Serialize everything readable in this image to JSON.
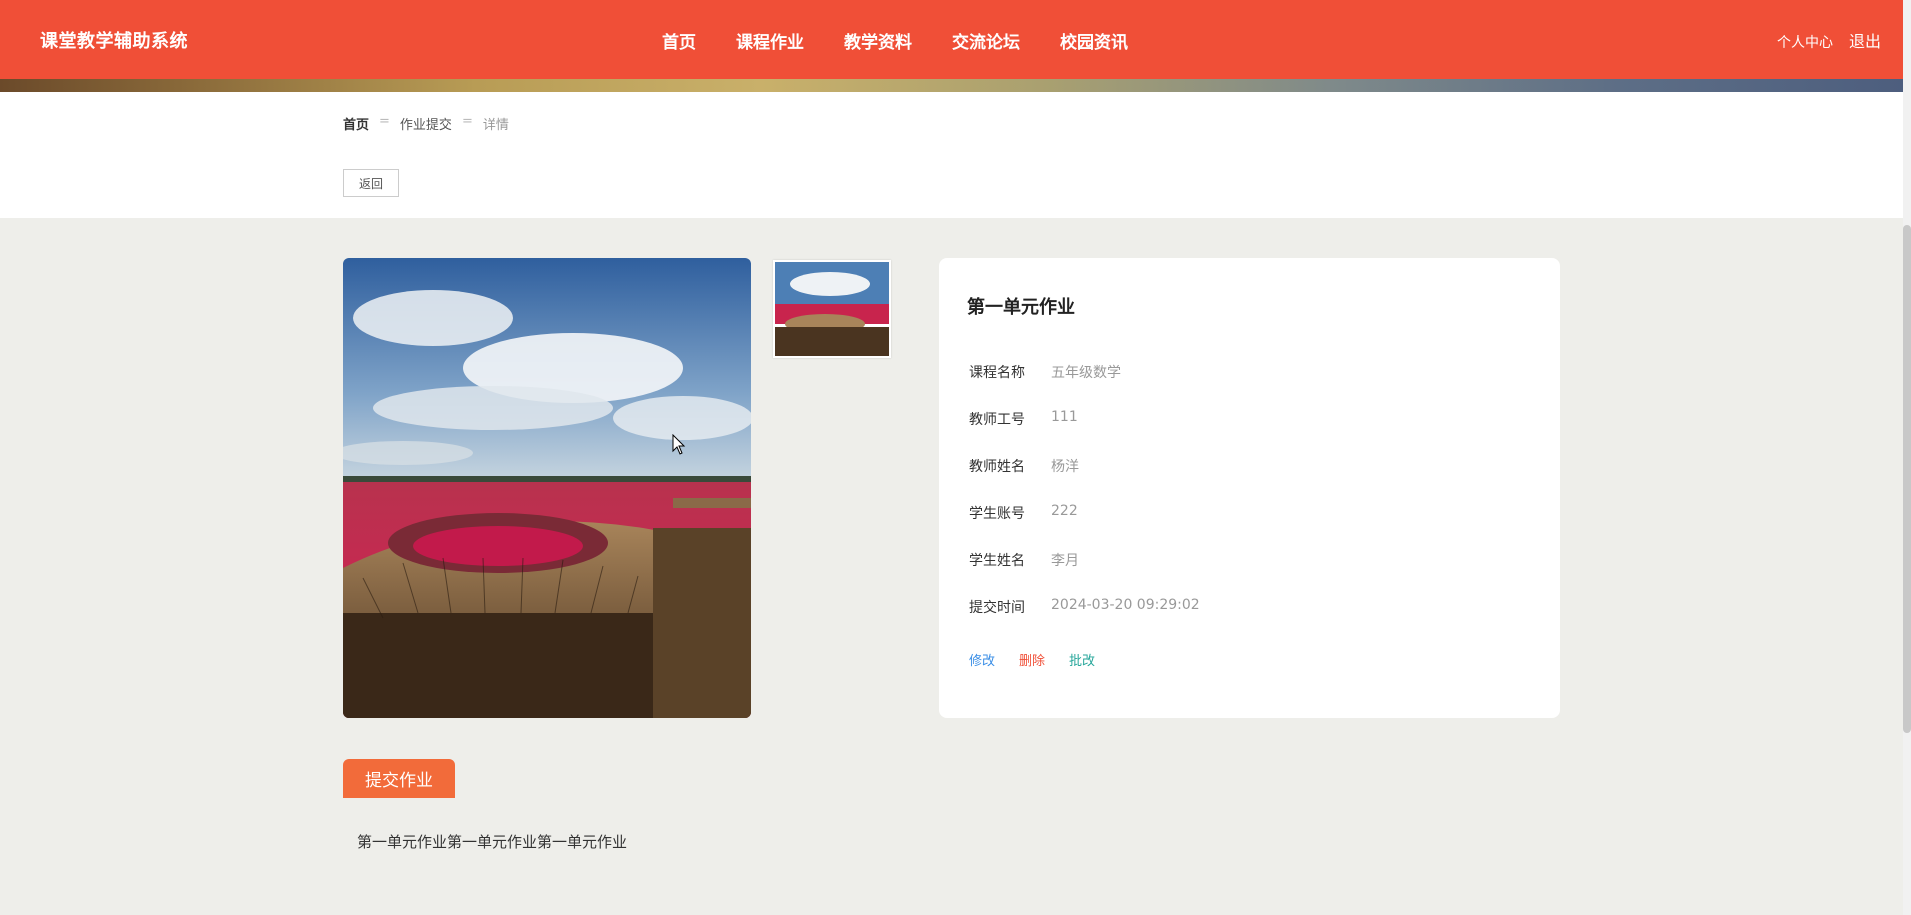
{
  "header": {
    "logo": "课堂教学辅助系统",
    "nav": [
      "首页",
      "课程作业",
      "教学资料",
      "交流论坛",
      "校园资讯"
    ],
    "user_center": "个人中心",
    "logout": "退出"
  },
  "breadcrumb": {
    "home": "首页",
    "separator": "=",
    "section": "作业提交",
    "current": "详情"
  },
  "back_button": "返回",
  "detail": {
    "title": "第一单元作业",
    "fields": [
      {
        "label": "课程名称",
        "value": "五年级数学"
      },
      {
        "label": "教师工号",
        "value": "111"
      },
      {
        "label": "教师姓名",
        "value": "杨洋"
      },
      {
        "label": "学生账号",
        "value": "222"
      },
      {
        "label": "学生姓名",
        "value": "李月"
      },
      {
        "label": "提交时间",
        "value": "2024-03-20 09:29:02"
      }
    ],
    "actions": {
      "edit": "修改",
      "delete": "删除",
      "review": "批改"
    }
  },
  "submit": {
    "tab_label": "提交作业",
    "content": "第一单元作业第一单元作业第一单元作业"
  },
  "colors": {
    "header": "#f04f37",
    "submit_tab": "#f26b3a",
    "edit": "#3a8ee6",
    "delete": "#f04f37",
    "review": "#26a69a"
  }
}
